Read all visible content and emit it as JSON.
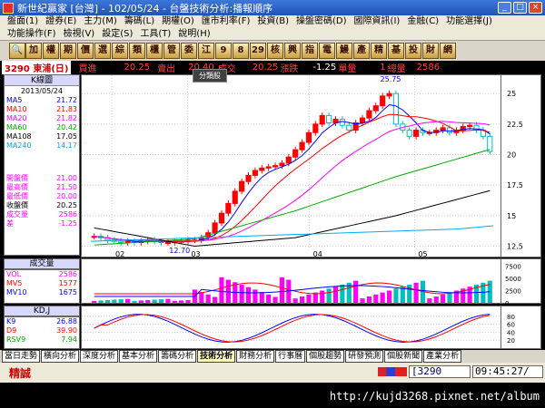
{
  "window": {
    "title": "新世紀贏家 [台灣] - 102/05/24 - 台盤技術分析:播報順序"
  },
  "menu": [
    "盤面(1)",
    "證券(E)",
    "主力(M)",
    "籌碼(L)",
    "期權(O)",
    "匯市利率(F)",
    "投資(B)",
    "操盤密碼(D)",
    "國際資訊(I)",
    "金融(C)",
    "功能選擇(J)",
    "功能操作(F)",
    "檢視(V)",
    "設定(S)",
    "工具(T)",
    "說明(H)"
  ],
  "toolbar": [
    "加",
    "權",
    "期",
    "價",
    "選",
    "綜",
    "類",
    "櫃",
    "管",
    "委",
    "江",
    "9",
    "8",
    "29",
    "核",
    "興",
    "指",
    "電",
    "鰻",
    "產",
    "精",
    "基",
    "投",
    "財",
    "網"
  ],
  "info": {
    "stock": "3290 東浦(日)",
    "buy_label": "買進",
    "buy": "20.25",
    "sell_label": "賣出",
    "sell": "20.40",
    "trade_label": "成交",
    "trade": "20.25",
    "chg_label": "漲跌",
    "chg": "-1.25",
    "vol_label": "單量",
    "vol": "1",
    "tvol_label": "總量",
    "tvol": "2586"
  },
  "tooltip": "分類股",
  "left": {
    "header": "K線圖",
    "date": "2013/05/24",
    "ma": [
      {
        "name": "MA5",
        "val": "21.72",
        "color": "#0000ff"
      },
      {
        "name": "MA10",
        "val": "21.83",
        "color": "#ff0000"
      },
      {
        "name": "MA20",
        "val": "21.82",
        "color": "#ff00ff"
      },
      {
        "name": "MA60",
        "val": "20.42",
        "color": "#00aa00"
      },
      {
        "name": "MA108",
        "val": "17.05",
        "color": "#000000"
      },
      {
        "name": "MA240",
        "val": "14.17",
        "color": "#00aaff"
      }
    ],
    "prices": [
      {
        "name": "開盤價",
        "val": "21.00",
        "color": "#ff00ff"
      },
      {
        "name": "最高價",
        "val": "21.50",
        "color": "#ff00ff"
      },
      {
        "name": "最低價",
        "val": "20.00",
        "color": "#ff00ff"
      },
      {
        "name": "收盤價",
        "val": "20.25",
        "color": "#000000"
      },
      {
        "name": "成交量",
        "val": "2586",
        "color": "#ff00ff"
      },
      {
        "name": "差",
        "val": "-1.25",
        "color": "#ff00ff"
      }
    ]
  },
  "chart_data": {
    "type": "candlestick",
    "x_ticks": [
      "02",
      "03",
      "04",
      "05"
    ],
    "y_ticks": [
      12.5,
      15.0,
      17.5,
      20.0,
      22.5,
      25.0
    ],
    "ylim": [
      11.5,
      26.5
    ],
    "max_label": "25.75",
    "min_label": "12.70",
    "close": [
      13.3,
      13.2,
      13.0,
      12.9,
      12.8,
      12.9,
      12.8,
      12.9,
      13.0,
      12.9,
      12.8,
      12.8,
      12.9,
      12.9,
      13.0,
      13.0,
      13.2,
      13.6,
      14.4,
      15.2,
      16.0,
      17.0,
      17.8,
      18.3,
      18.7,
      18.9,
      19.0,
      19.1,
      19.3,
      19.8,
      20.4,
      21.0,
      21.8,
      22.5,
      23.2,
      22.6,
      22.9,
      22.4,
      22.0,
      22.6,
      23.0,
      23.6,
      24.0,
      24.8,
      25.0,
      22.5,
      22.0,
      21.5,
      22.0,
      21.8,
      21.8,
      22.0,
      22.2,
      21.8,
      22.0,
      22.3,
      22.4,
      22.0,
      21.5,
      20.25
    ],
    "ma60": [
      12.6,
      null,
      null,
      null,
      null,
      null,
      null,
      null,
      null,
      null,
      null,
      null,
      null,
      null,
      null,
      13.1,
      null,
      null,
      null,
      null,
      null,
      null,
      null,
      null,
      null,
      null,
      null,
      null,
      null,
      null,
      15.4,
      null,
      null,
      null,
      null,
      null,
      null,
      null,
      null,
      null,
      null,
      null,
      null,
      null,
      null,
      18.2,
      null,
      null,
      null,
      null,
      null,
      null,
      null,
      null,
      null,
      null,
      null,
      null,
      null,
      20.42
    ],
    "ma108": [
      14.0,
      null,
      null,
      null,
      null,
      null,
      null,
      null,
      null,
      null,
      null,
      null,
      null,
      null,
      null,
      12.5,
      null,
      null,
      null,
      null,
      null,
      null,
      null,
      null,
      null,
      null,
      null,
      null,
      null,
      null,
      13.2,
      null,
      null,
      null,
      null,
      null,
      null,
      null,
      null,
      null,
      null,
      null,
      null,
      null,
      null,
      15.0,
      null,
      null,
      null,
      null,
      null,
      null,
      null,
      null,
      null,
      null,
      null,
      null,
      null,
      17.05
    ],
    "ma240": [
      12.9,
      13.0,
      13.1,
      13.2,
      13.3,
      13.4,
      13.5,
      13.6,
      13.7,
      13.8,
      13.9,
      14.17
    ],
    "volume": {
      "label": "成交量",
      "ticks": [
        0,
        2500,
        5000,
        7500
      ],
      "series": [
        {
          "name": "VOL",
          "val": "2586",
          "color": "#ff00ff"
        },
        {
          "name": "MV5",
          "val": "1577",
          "color": "#ff0000"
        },
        {
          "name": "MV10",
          "val": "1675",
          "color": "#0000ff"
        }
      ]
    },
    "kd": {
      "label": "KD,J",
      "ticks": [
        20,
        40,
        60,
        80
      ],
      "series": [
        {
          "name": "K9",
          "val": "26.88",
          "color": "#0000ff"
        },
        {
          "name": "D9",
          "val": "39.90",
          "color": "#ff0000"
        },
        {
          "name": "RSV9",
          "val": "7.94",
          "color": "#00aa00"
        }
      ]
    }
  },
  "tabs": [
    "當日走勢",
    "橫向分析",
    "深度分析",
    "基本分析",
    "籌碼分析",
    "技術分析",
    "財務分析",
    "行事曆",
    "個股趨勢",
    "研發預測",
    "個股新聞",
    "產業分析"
  ],
  "tabs_active": 5,
  "status": {
    "label": "精誠",
    "code": "[3290",
    "time": "09:45:27/"
  },
  "watermark": "http://kujd3268.pixnet.net/album",
  "colors": {
    "up": "#ff0000",
    "down": "#00bfbf",
    "accent": "#2152b5"
  }
}
